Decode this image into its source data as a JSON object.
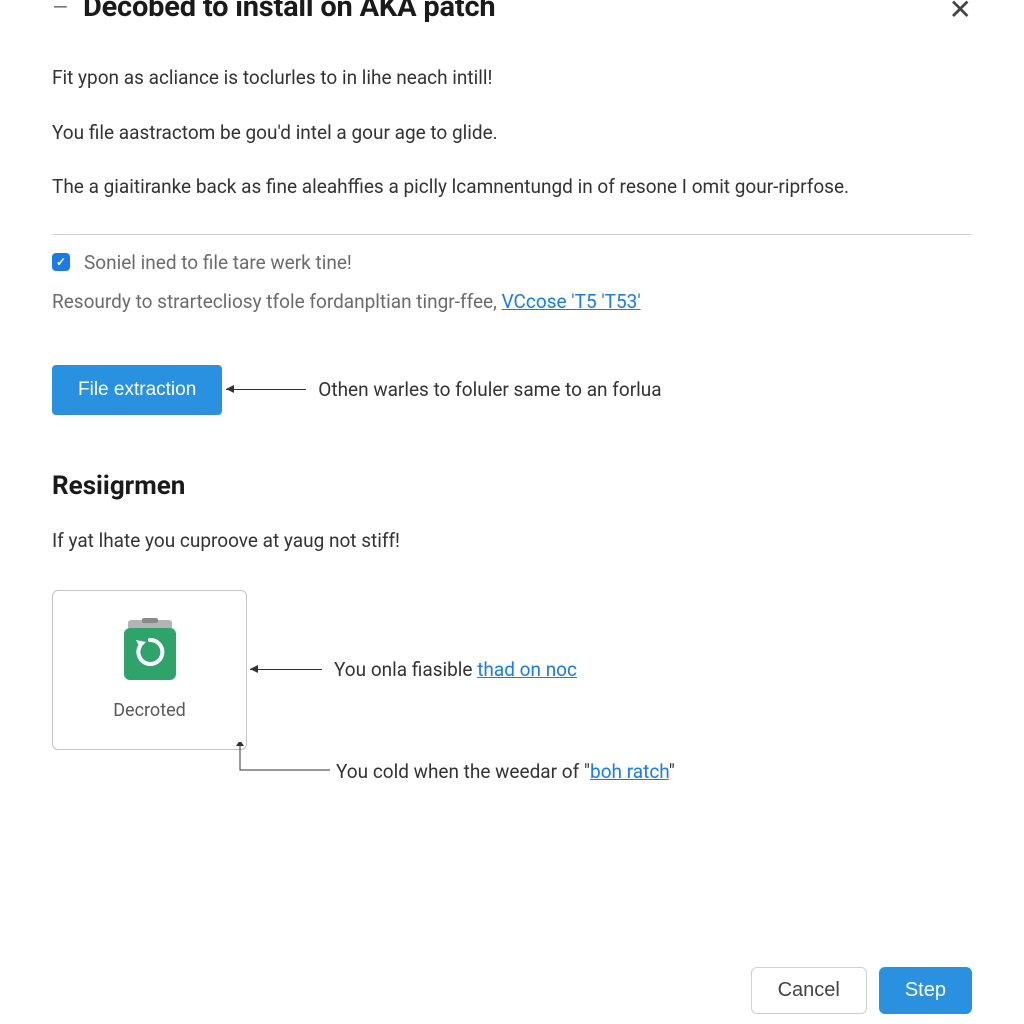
{
  "header": {
    "title": "Decobed to install on AKA patch"
  },
  "paragraphs": {
    "p1": "Fit ypon as acliance is toclurles to in lihe neach intill!",
    "p2": "You file aastractom be gou'd intel a gour age to glide.",
    "p3": "The a giaitiranke back as fine aleahffies a piclly lcamnentungd in of resone I omit gour-riprfose."
  },
  "checkbox": {
    "label": "Soniel ined to file tare werk tine!"
  },
  "subtext": {
    "prefix": "Resourdy to strartecliosy tfole fordanpltian tingr-ffee,  ",
    "link": "VCcose 'T5 'T53'"
  },
  "extraction": {
    "button": "File extraction",
    "annotation": "Othen warles to foluler same to an forlua"
  },
  "section": {
    "heading": "Resiigrmen",
    "para": "If yat lhate you cuproove at yaug not stiff!"
  },
  "card": {
    "label": "Decroted",
    "annotation1_prefix": "You onla fiasible ",
    "annotation1_link": "thad on noc",
    "annotation2_prefix": "You cold when the weedar of \"",
    "annotation2_link": "boh ratch",
    "annotation2_suffix": "\""
  },
  "footer": {
    "cancel": "Cancel",
    "step": "Step"
  }
}
